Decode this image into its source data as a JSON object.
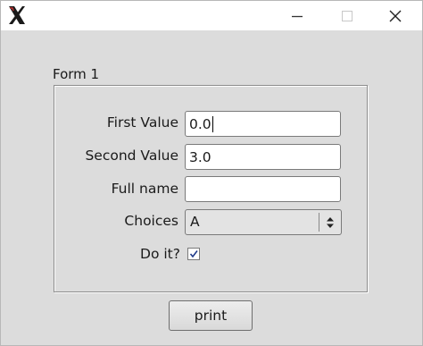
{
  "window": {
    "app_icon": "x-window-icon",
    "controls": {
      "minimize_icon": "minimize-icon",
      "maximize_icon": "maximize-icon",
      "close_icon": "close-icon"
    }
  },
  "form": {
    "group_title": "Form 1",
    "first_value": {
      "label": "First Value",
      "value": "0.0"
    },
    "second_value": {
      "label": "Second Value",
      "value": "3.0"
    },
    "full_name": {
      "label": "Full name",
      "value": ""
    },
    "choices": {
      "label": "Choices",
      "selected": "A"
    },
    "do_it": {
      "label": "Do it?",
      "checked": true
    }
  },
  "actions": {
    "print_label": "print"
  }
}
